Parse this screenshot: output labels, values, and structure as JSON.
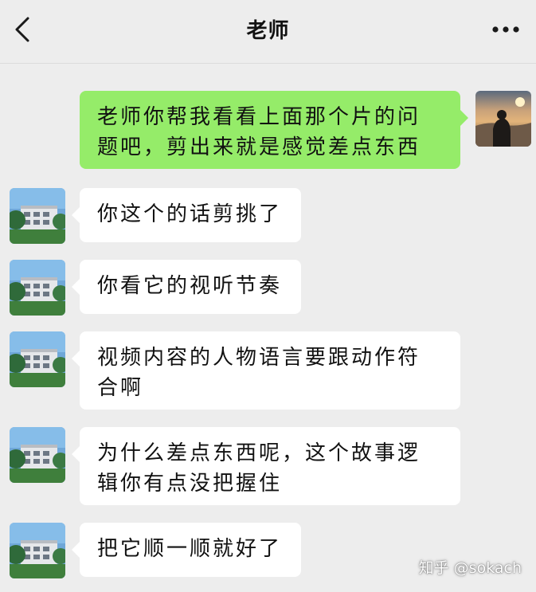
{
  "header": {
    "title": "老师",
    "back_icon": "chevron-left-icon",
    "more_icon": "ellipsis-icon"
  },
  "messages": [
    {
      "sender": "me",
      "text": "老师你帮我看看上面那个片的问题吧，剪出来就是感觉差点东西"
    },
    {
      "sender": "teacher",
      "text": "你这个的话剪挑了"
    },
    {
      "sender": "teacher",
      "text": "你看它的视听节奏"
    },
    {
      "sender": "teacher",
      "text": "视频内容的人物语言要跟动作符合啊"
    },
    {
      "sender": "teacher",
      "text": "为什么差点东西呢，这个故事逻辑你有点没把握住"
    },
    {
      "sender": "teacher",
      "text": "把它顺一顺就好了"
    }
  ],
  "watermark": "知乎 @sokach",
  "colors": {
    "background": "#ededed",
    "outgoing_bubble": "#95ec69",
    "incoming_bubble": "#ffffff"
  }
}
